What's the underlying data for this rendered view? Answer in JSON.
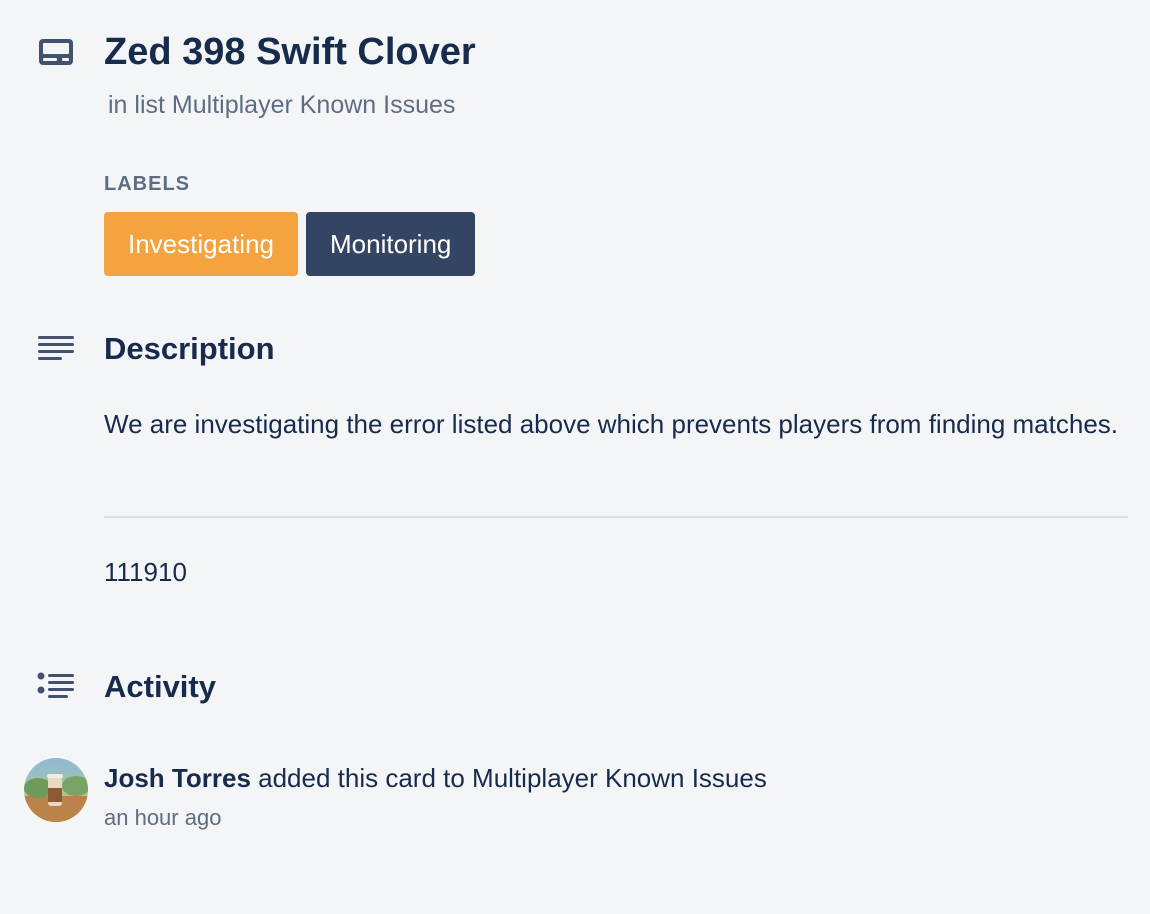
{
  "card": {
    "title": "Zed 398 Swift Clover",
    "list_prefix": "in list",
    "list_name": "Multiplayer Known Issues",
    "icon": "card-icon"
  },
  "labels": {
    "heading": "LABELS",
    "items": [
      {
        "text": "Investigating",
        "color": "#f5a33e"
      },
      {
        "text": "Monitoring",
        "color": "#344563"
      }
    ]
  },
  "description": {
    "heading": "Description",
    "icon": "description-icon",
    "text": "We are investigating the error listed above which prevents players from finding matches.",
    "extra": "111910"
  },
  "activity": {
    "heading": "Activity",
    "icon": "activity-icon",
    "entries": [
      {
        "author": "Josh Torres",
        "action": "added this card to Multiplayer Known Issues",
        "time": "an hour ago",
        "avatar": "user-avatar"
      }
    ]
  }
}
